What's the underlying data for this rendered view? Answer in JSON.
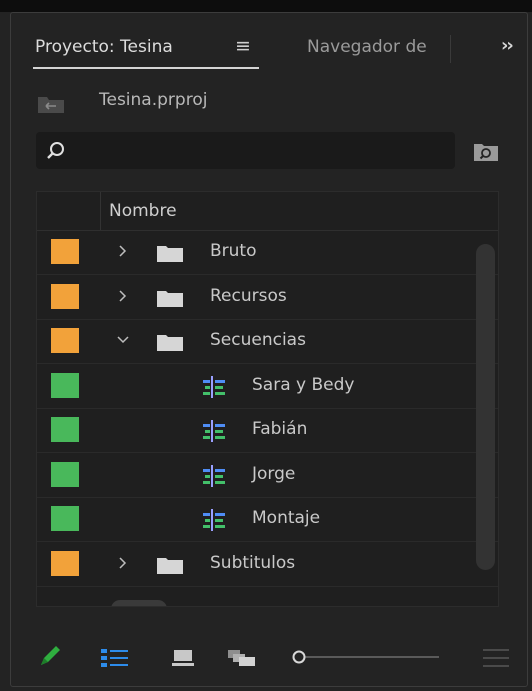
{
  "tabs": {
    "active_label": "Proyecto: Tesina",
    "menu_icon": "hamburger-icon",
    "inactive_label": "Navegador de",
    "overflow_icon": "double-chevron-right-icon"
  },
  "project": {
    "file_name": "Tesina.prproj"
  },
  "search": {
    "value": "",
    "placeholder": ""
  },
  "list": {
    "column_header": "Nombre",
    "items": [
      {
        "label": "Bruto",
        "type": "folder",
        "expanded": false,
        "color": "#f2a23a"
      },
      {
        "label": "Recursos",
        "type": "folder",
        "expanded": false,
        "color": "#f2a23a"
      },
      {
        "label": "Secuencias",
        "type": "folder",
        "expanded": true,
        "color": "#f2a23a"
      },
      {
        "label": "Sara y Bedy",
        "type": "sequence",
        "color": "#49b85b"
      },
      {
        "label": "Fabián",
        "type": "sequence",
        "color": "#49b85b"
      },
      {
        "label": "Jorge",
        "type": "sequence",
        "color": "#49b85b"
      },
      {
        "label": "Montaje",
        "type": "sequence",
        "color": "#49b85b"
      },
      {
        "label": "Subtitulos",
        "type": "folder",
        "expanded": false,
        "color": "#f2a23a"
      }
    ]
  },
  "toolbar": {
    "icons": [
      "pencil-icon",
      "list-view-icon",
      "icon-view-icon",
      "freeform-view-icon",
      "zoom-slider",
      "sort-menu-icon"
    ],
    "accent": "#2d8ceb",
    "pencil_color": "#2fae3f"
  }
}
